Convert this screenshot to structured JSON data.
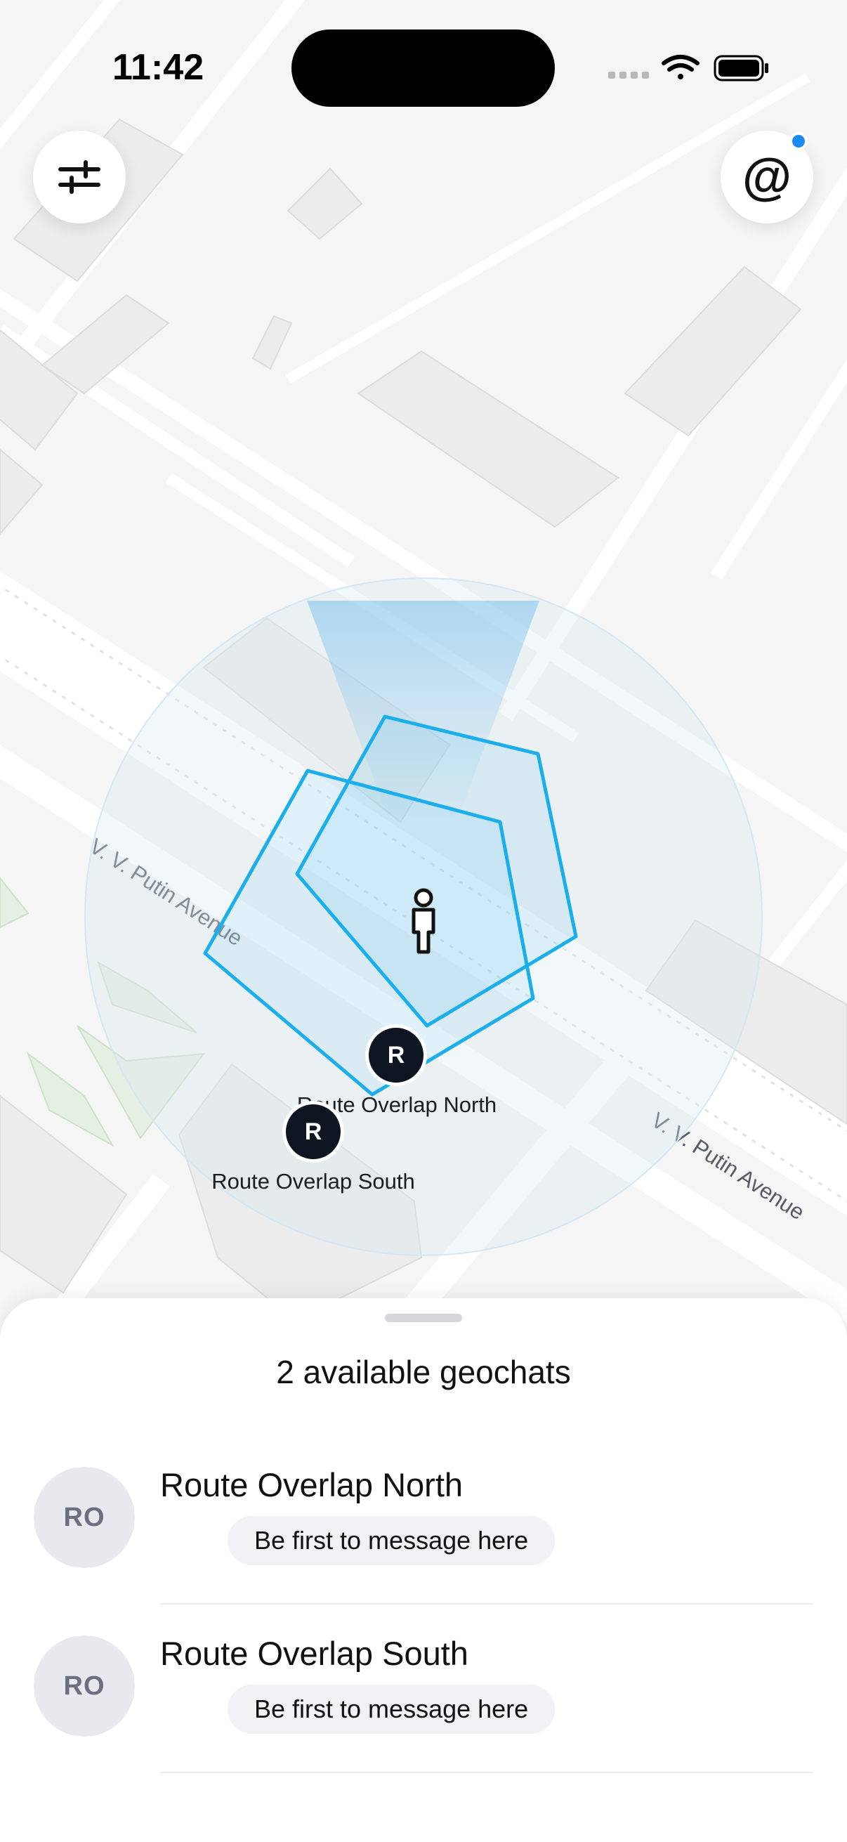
{
  "status_bar": {
    "time": "11:42"
  },
  "map": {
    "street_name": "V. V. Putin Avenue",
    "route_color": "#1aaeec",
    "markers": [
      {
        "initial": "R",
        "label": "Route Overlap North"
      },
      {
        "initial": "R",
        "label": "Route Overlap South"
      }
    ]
  },
  "top_controls": {
    "left_icon": "filter-sliders-icon",
    "right_icon": "at-sign-icon",
    "right_has_notification": true,
    "notification_color": "#1a8bf0"
  },
  "sheet": {
    "title": "2 available geochats",
    "items": [
      {
        "avatar": "RO",
        "title": "Route Overlap North",
        "subtitle": "Be first to message here"
      },
      {
        "avatar": "RO",
        "title": "Route Overlap South",
        "subtitle": "Be first to message here"
      }
    ]
  }
}
